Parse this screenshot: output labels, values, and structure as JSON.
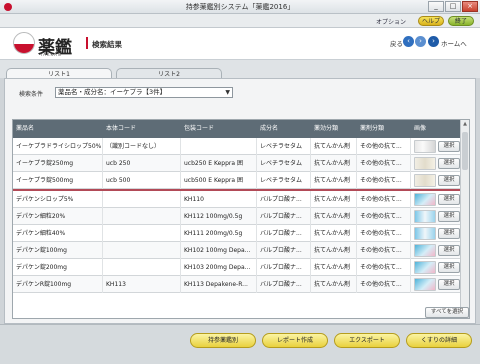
{
  "window": {
    "title": "持参薬鑑別システム「薬鑑2016」",
    "minimize": "_",
    "maximize": "□",
    "close": "×"
  },
  "toolbar": {
    "option": "オプション",
    "help": "ヘルプ",
    "exit": "終了"
  },
  "header": {
    "logo_kanji": "薬鑑",
    "logo_roman": "YAKKAN",
    "page_title": "検索結果",
    "back_label": "戻る",
    "home_label": "ホームへ"
  },
  "tabs": [
    {
      "label": "リスト1"
    },
    {
      "label": "リスト2"
    }
  ],
  "search": {
    "condition_label": "検索条件",
    "condition_value": "薬品名・成分名：イーケプラ【3件】"
  },
  "table": {
    "columns": [
      "薬品名",
      "本体コード",
      "包装コード",
      "成分名",
      "薬効分類",
      "薬剤分類",
      "画像"
    ],
    "select_label": "選択",
    "rows": [
      {
        "name": "イーケプラドライシロップ50%",
        "body_code": "（識別コードなし）",
        "pkg_code": "",
        "ingredient": "レベチラセタム",
        "efficacy": "抗てんかん剤",
        "category": "その他の抗て...",
        "image": "a"
      },
      {
        "name": "イーケプラ錠250mg",
        "body_code": "ucb 250",
        "pkg_code": "ucb250 E Keppra 囲",
        "ingredient": "レベチラセタム",
        "efficacy": "抗てんかん剤",
        "category": "その他の抗て...",
        "image": "b"
      },
      {
        "name": "イーケプラ錠500mg",
        "body_code": "ucb 500",
        "pkg_code": "ucb500 E Keppra 囲",
        "ingredient": "レベチラセタム",
        "efficacy": "抗てんかん剤",
        "category": "その他の抗て...",
        "image": "b"
      },
      {
        "name": "デパケンシロップ5%",
        "body_code": "",
        "pkg_code": "KH110",
        "ingredient": "バルプロ酸ナ...",
        "efficacy": "抗てんかん剤",
        "category": "その他の抗て...",
        "image": "c"
      },
      {
        "name": "デパケン細粒20%",
        "body_code": "",
        "pkg_code": "KH112 100mg/0.5g",
        "ingredient": "バルプロ酸ナ...",
        "efficacy": "抗てんかん剤",
        "category": "その他の抗て...",
        "image": "d"
      },
      {
        "name": "デパケン細粒40%",
        "body_code": "",
        "pkg_code": "KH111 200mg/0.5g",
        "ingredient": "バルプロ酸ナ...",
        "efficacy": "抗てんかん剤",
        "category": "その他の抗て...",
        "image": "d"
      },
      {
        "name": "デパケン錠100mg",
        "body_code": "",
        "pkg_code": "KH102 100mg Depa...",
        "ingredient": "バルプロ酸ナ...",
        "efficacy": "抗てんかん剤",
        "category": "その他の抗て...",
        "image": "c"
      },
      {
        "name": "デパケン錠200mg",
        "body_code": "",
        "pkg_code": "KH103 200mg Depa...",
        "ingredient": "バルプロ酸ナ...",
        "efficacy": "抗てんかん剤",
        "category": "その他の抗て...",
        "image": "c"
      },
      {
        "name": "デパケンR錠100mg",
        "body_code": "KH113",
        "pkg_code": "KH113 Depakene-R...",
        "ingredient": "バルプロ酸ナ...",
        "efficacy": "抗てんかん剤",
        "category": "その他の抗て...",
        "image": "c"
      }
    ],
    "select_all": "すべてを選択"
  },
  "actions": {
    "identify": "持参薬鑑別",
    "report": "レポート作成",
    "export": "エクスポート",
    "detail": "くすりの詳細"
  }
}
